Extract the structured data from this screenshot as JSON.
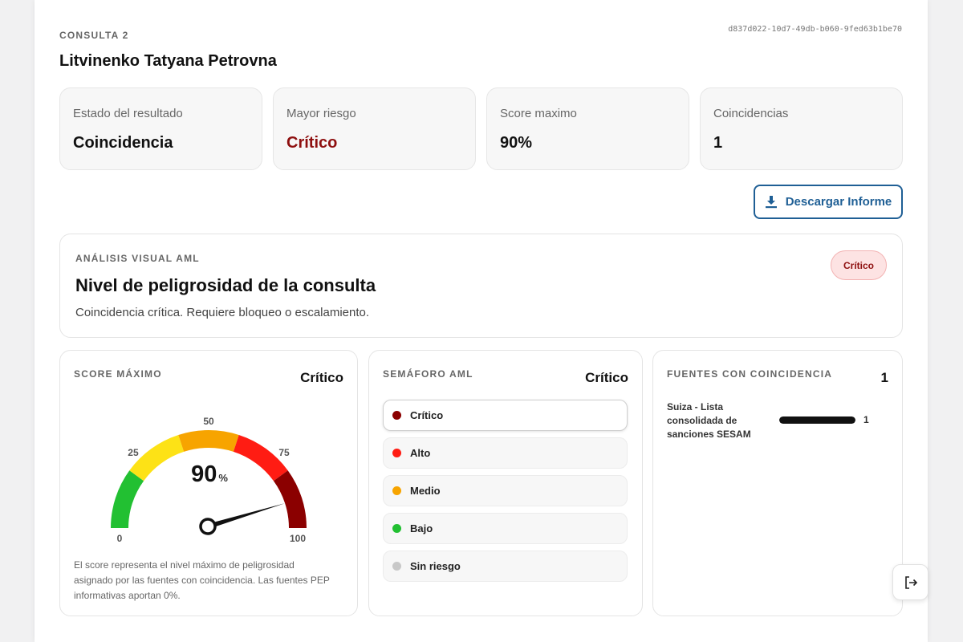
{
  "header": {
    "consulta_label": "CONSULTA 2",
    "uuid": "d837d022-10d7-49db-b060-9fed63b1be70",
    "person_name": "Litvinenko Tatyana Petrovna"
  },
  "stats": [
    {
      "label": "Estado del resultado",
      "value": "Coincidencia"
    },
    {
      "label": "Mayor riesgo",
      "value": "Crítico"
    },
    {
      "label": "Score maximo",
      "value": "90%"
    },
    {
      "label": "Coincidencias",
      "value": "1"
    }
  ],
  "actions": {
    "download_label": "Descargar Informe"
  },
  "analysis": {
    "eyebrow": "ANÁLISIS VISUAL AML",
    "title": "Nivel de peligrosidad de la consulta",
    "description": "Coincidencia crítica. Requiere bloqueo o escalamiento.",
    "badge": "Crítico"
  },
  "score_card": {
    "eyebrow": "SCORE MÁXIMO",
    "level": "Crítico",
    "score": 90,
    "score_text": "90",
    "unit": "%",
    "gauge_min": 0,
    "gauge_max": 100,
    "ticks": [
      {
        "value": 0,
        "label": "0"
      },
      {
        "value": 25,
        "label": "25"
      },
      {
        "value": 50,
        "label": "50"
      },
      {
        "value": 75,
        "label": "75"
      },
      {
        "value": 100,
        "label": "100"
      }
    ],
    "bands": [
      {
        "from": 0,
        "to": 20,
        "color": "#22c032"
      },
      {
        "from": 20,
        "to": 40,
        "color": "#fde216"
      },
      {
        "from": 40,
        "to": 60,
        "color": "#f7a400"
      },
      {
        "from": 60,
        "to": 80,
        "color": "#ff1c13"
      },
      {
        "from": 80,
        "to": 100,
        "color": "#8b0000"
      }
    ],
    "note": "El score representa el nivel máximo de peligrosidad asignado por las fuentes con coincidencia. Las fuentes PEP informativas aportan 0%."
  },
  "semaforo": {
    "eyebrow": "SEMÁFORO AML",
    "level": "Crítico",
    "items": [
      {
        "label": "Crítico",
        "color": "#8b0000",
        "active": true
      },
      {
        "label": "Alto",
        "color": "#ff1c13",
        "active": false
      },
      {
        "label": "Medio",
        "color": "#f7a400",
        "active": false
      },
      {
        "label": "Bajo",
        "color": "#22c032",
        "active": false
      },
      {
        "label": "Sin riesgo",
        "color": "#c8c8c8",
        "active": false
      }
    ]
  },
  "fuentes": {
    "eyebrow": "FUENTES CON COINCIDENCIA",
    "count": "1",
    "sources": [
      {
        "name": "Suiza - Lista consolidada de sanciones SESAM",
        "count": "1",
        "fraction": 1.0
      }
    ]
  },
  "colors": {
    "accent": "#1f5f95",
    "critical": "#8e0f0f"
  },
  "icons": {
    "download": "download-icon",
    "logout": "logout-icon"
  }
}
